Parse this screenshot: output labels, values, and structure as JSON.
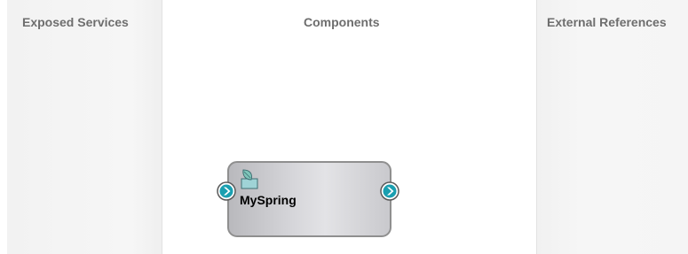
{
  "lanes": {
    "exposed_services": "Exposed Services",
    "components": "Components",
    "external_references": "External References"
  },
  "component": {
    "name": "MySpring",
    "icon": "spring-bean-icon"
  },
  "colors": {
    "lane_background": "#f4f4f4",
    "lane_title": "#6e6e6e",
    "component_border": "#8f8f8f",
    "port_teal": "#1a9fb0"
  }
}
